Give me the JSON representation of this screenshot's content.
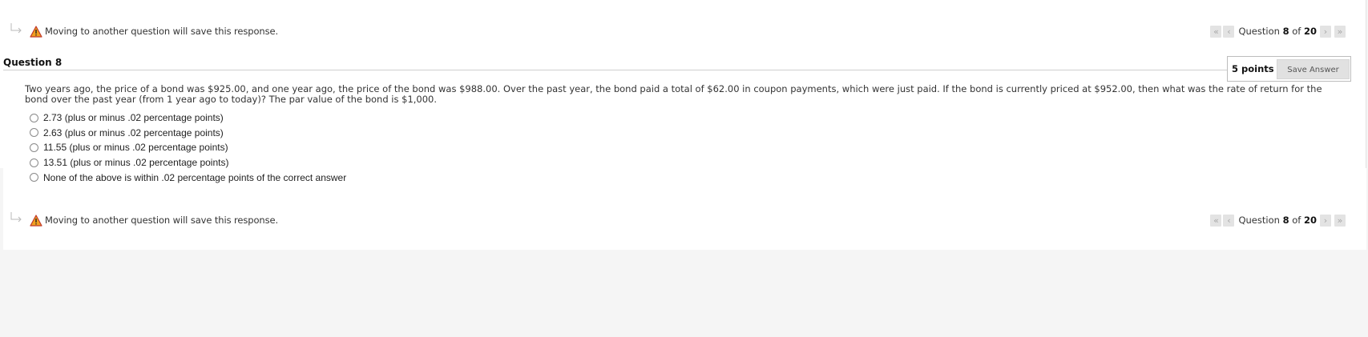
{
  "notice": {
    "warning_text": "Moving to another question will save this response.",
    "arrow_icon": "return-arrow-icon",
    "warning_icon": "warning-triangle-icon"
  },
  "pager": {
    "first_icon": "double-chevron-left-icon",
    "prev_icon": "chevron-left-icon",
    "next_icon": "chevron-right-icon",
    "last_icon": "double-chevron-right-icon",
    "label_prefix": "Question",
    "current": "8",
    "of_text": "of",
    "total": "20"
  },
  "question": {
    "title": "Question 8",
    "points": "5 points",
    "save_label": "Save Answer",
    "text": "Two years ago, the price of a bond was $925.00, and one year ago, the price of the bond was $988.00. Over the past year, the bond paid a total of $62.00 in coupon payments, which were just paid. If the bond is currently priced at $952.00, then what was the rate of return for the bond over the past year (from 1 year ago to today)? The par value of the bond is $1,000.",
    "options": [
      "2.73 (plus or minus .02 percentage points)",
      "2.63 (plus or minus .02 percentage points)",
      "11.55 (plus or minus .02 percentage points)",
      "13.51 (plus or minus .02 percentage points)",
      "None of the above is within .02 percentage points of the correct answer"
    ]
  },
  "colors": {
    "warning_fill": "#f0a020",
    "warning_stroke": "#c0392b",
    "page_background": "#f5f5f5"
  }
}
